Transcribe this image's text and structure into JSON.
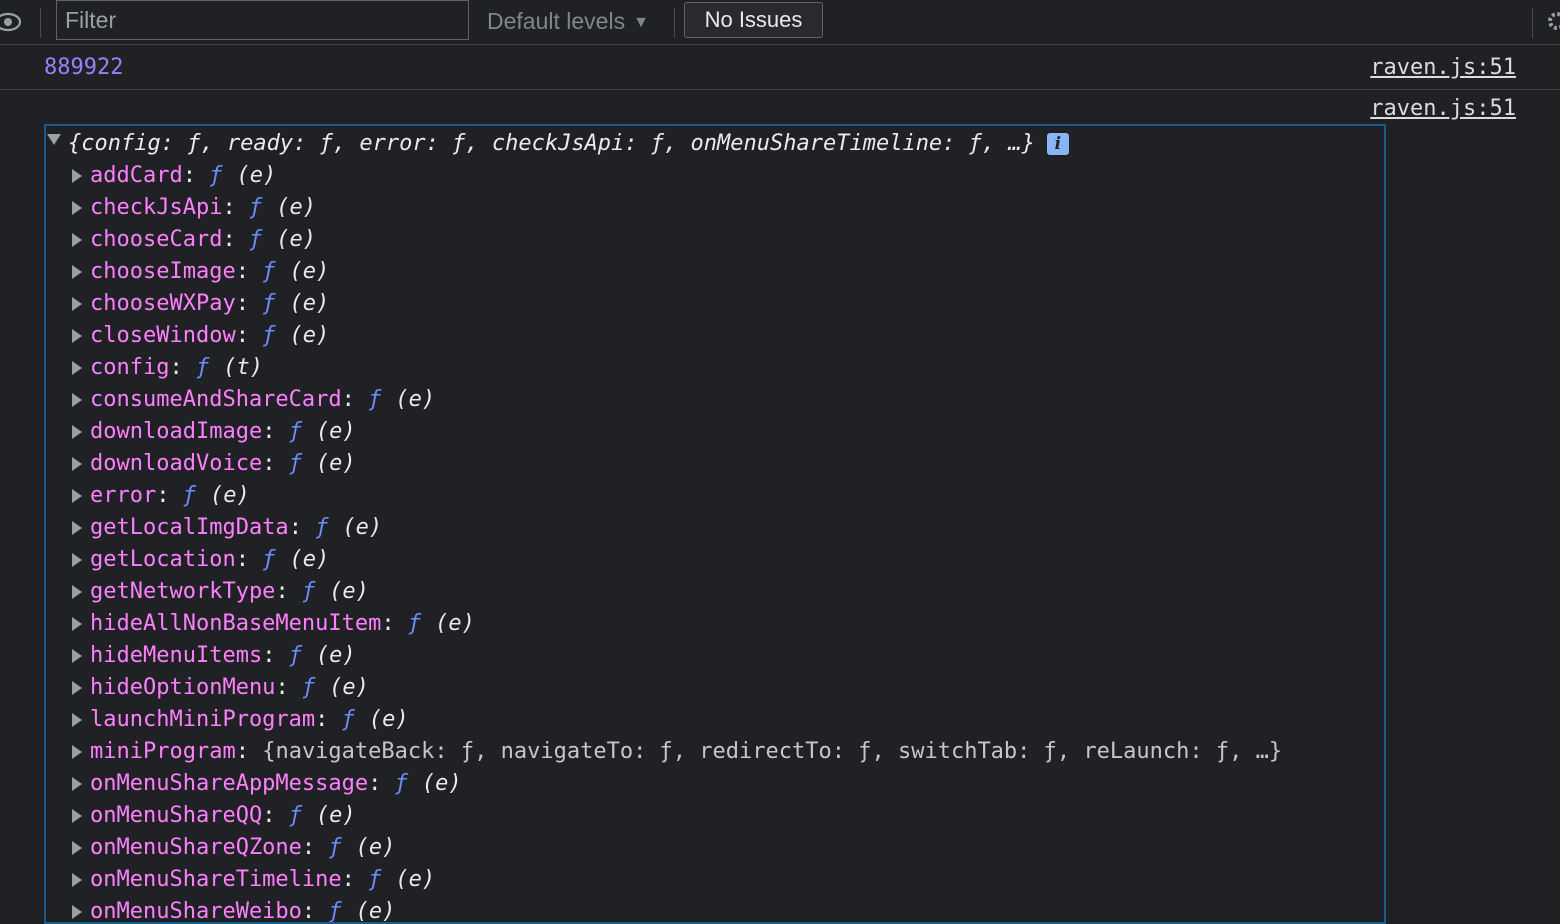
{
  "toolbar": {
    "filter_placeholder": "Filter",
    "levels_label": "Default levels",
    "issues_label": "No Issues"
  },
  "messages": [
    {
      "value": "889922",
      "source": "raven.js:51"
    },
    {
      "source": "raven.js:51"
    }
  ],
  "object": {
    "summary": "{config: ƒ, ready: ƒ, error: ƒ, checkJsApi: ƒ, onMenuShareTimeline: ƒ, …}",
    "info_badge": "i",
    "properties": [
      {
        "name": "addCard",
        "f": "ƒ",
        "args": "(e)"
      },
      {
        "name": "checkJsApi",
        "f": "ƒ",
        "args": "(e)"
      },
      {
        "name": "chooseCard",
        "f": "ƒ",
        "args": "(e)"
      },
      {
        "name": "chooseImage",
        "f": "ƒ",
        "args": "(e)"
      },
      {
        "name": "chooseWXPay",
        "f": "ƒ",
        "args": "(e)"
      },
      {
        "name": "closeWindow",
        "f": "ƒ",
        "args": "(e)"
      },
      {
        "name": "config",
        "f": "ƒ",
        "args": "(t)"
      },
      {
        "name": "consumeAndShareCard",
        "f": "ƒ",
        "args": "(e)"
      },
      {
        "name": "downloadImage",
        "f": "ƒ",
        "args": "(e)"
      },
      {
        "name": "downloadVoice",
        "f": "ƒ",
        "args": "(e)"
      },
      {
        "name": "error",
        "f": "ƒ",
        "args": "(e)"
      },
      {
        "name": "getLocalImgData",
        "f": "ƒ",
        "args": "(e)"
      },
      {
        "name": "getLocation",
        "f": "ƒ",
        "args": "(e)"
      },
      {
        "name": "getNetworkType",
        "f": "ƒ",
        "args": "(e)"
      },
      {
        "name": "hideAllNonBaseMenuItem",
        "f": "ƒ",
        "args": "(e)"
      },
      {
        "name": "hideMenuItems",
        "f": "ƒ",
        "args": "(e)"
      },
      {
        "name": "hideOptionMenu",
        "f": "ƒ",
        "args": "(e)"
      },
      {
        "name": "launchMiniProgram",
        "f": "ƒ",
        "args": "(e)"
      },
      {
        "name": "miniProgram",
        "value": "{navigateBack: ƒ, navigateTo: ƒ, redirectTo: ƒ, switchTab: ƒ, reLaunch: ƒ, …}"
      },
      {
        "name": "onMenuShareAppMessage",
        "f": "ƒ",
        "args": "(e)"
      },
      {
        "name": "onMenuShareQQ",
        "f": "ƒ",
        "args": "(e)"
      },
      {
        "name": "onMenuShareQZone",
        "f": "ƒ",
        "args": "(e)"
      },
      {
        "name": "onMenuShareTimeline",
        "f": "ƒ",
        "args": "(e)"
      },
      {
        "name": "onMenuShareWeibo",
        "f": "ƒ",
        "args": "(e)"
      }
    ]
  },
  "colors": {
    "background": "#202124",
    "property_name": "#ff80ff",
    "function_f": "#6b8cff",
    "number": "#9980ff",
    "selection_border": "#1a5a8c"
  }
}
